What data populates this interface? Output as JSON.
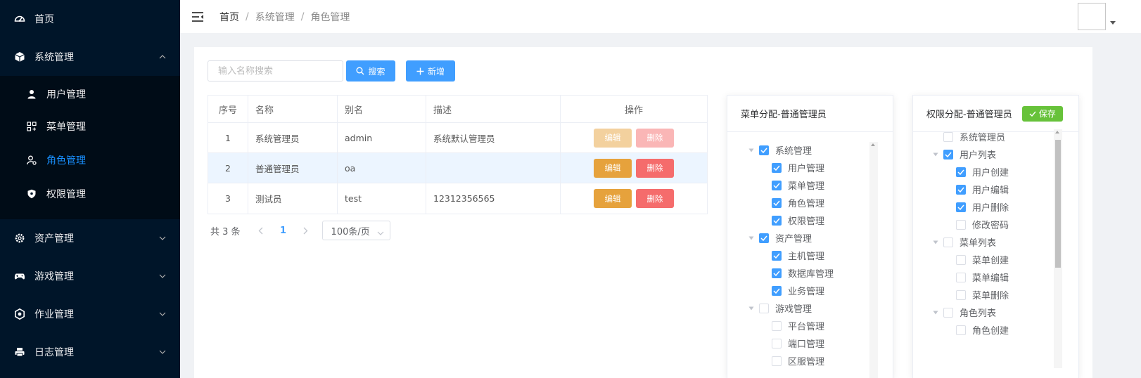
{
  "sidebar": {
    "home": "首页",
    "system": "系统管理",
    "system_children": [
      "用户管理",
      "菜单管理",
      "角色管理",
      "权限管理"
    ],
    "assets": "资产管理",
    "games": "游戏管理",
    "jobs": "作业管理",
    "logs": "日志管理"
  },
  "header": {
    "breadcrumb": [
      "首页",
      "系统管理",
      "角色管理"
    ],
    "separator": "/"
  },
  "toolbar": {
    "search_placeholder": "输入名称搜索",
    "search_label": "搜索",
    "add_label": "新增"
  },
  "table": {
    "columns": [
      "序号",
      "名称",
      "别名",
      "描述",
      "操作"
    ],
    "rows": [
      {
        "index": "1",
        "name": "系统管理员",
        "alias": "admin",
        "desc": "系统默认管理员",
        "edit": "编辑",
        "delete": "删除"
      },
      {
        "index": "2",
        "name": "普通管理员",
        "alias": "oa",
        "desc": "",
        "edit": "编辑",
        "delete": "删除"
      },
      {
        "index": "3",
        "name": "测试员",
        "alias": "test",
        "desc": "12312356565",
        "edit": "编辑",
        "delete": "删除"
      }
    ]
  },
  "pagination": {
    "total": "共 3 条",
    "current": "1",
    "page_size": "100条/页"
  },
  "menu_panel": {
    "title": "菜单分配-普通管理员",
    "nodes": [
      {
        "label": "系统管理",
        "checked": true
      },
      {
        "label": "用户管理",
        "checked": true
      },
      {
        "label": "菜单管理",
        "checked": true
      },
      {
        "label": "角色管理",
        "checked": true
      },
      {
        "label": "权限管理",
        "checked": true
      },
      {
        "label": "资产管理",
        "checked": true
      },
      {
        "label": "主机管理",
        "checked": true
      },
      {
        "label": "数据库管理",
        "checked": true
      },
      {
        "label": "业务管理",
        "checked": true
      },
      {
        "label": "游戏管理",
        "checked": false
      },
      {
        "label": "平台管理",
        "checked": false
      },
      {
        "label": "端口管理",
        "checked": false
      },
      {
        "label": "区服管理",
        "checked": false
      }
    ]
  },
  "perm_panel": {
    "title": "权限分配-普通管理员",
    "save_label": "保存",
    "nodes": [
      {
        "label": "系统管理员",
        "checked": false
      },
      {
        "label": "用户列表",
        "checked": true
      },
      {
        "label": "用户创建",
        "checked": true
      },
      {
        "label": "用户编辑",
        "checked": true
      },
      {
        "label": "用户删除",
        "checked": true
      },
      {
        "label": "修改密码",
        "checked": false
      },
      {
        "label": "菜单列表",
        "checked": false
      },
      {
        "label": "菜单创建",
        "checked": false
      },
      {
        "label": "菜单编辑",
        "checked": false
      },
      {
        "label": "菜单删除",
        "checked": false
      },
      {
        "label": "角色列表",
        "checked": false
      },
      {
        "label": "角色创建",
        "checked": false
      }
    ]
  },
  "colors": {
    "sidebar_bg": "#001529",
    "primary": "#409eff",
    "warning": "#e6a23c",
    "danger": "#f56c6c",
    "success": "#67c23a"
  }
}
